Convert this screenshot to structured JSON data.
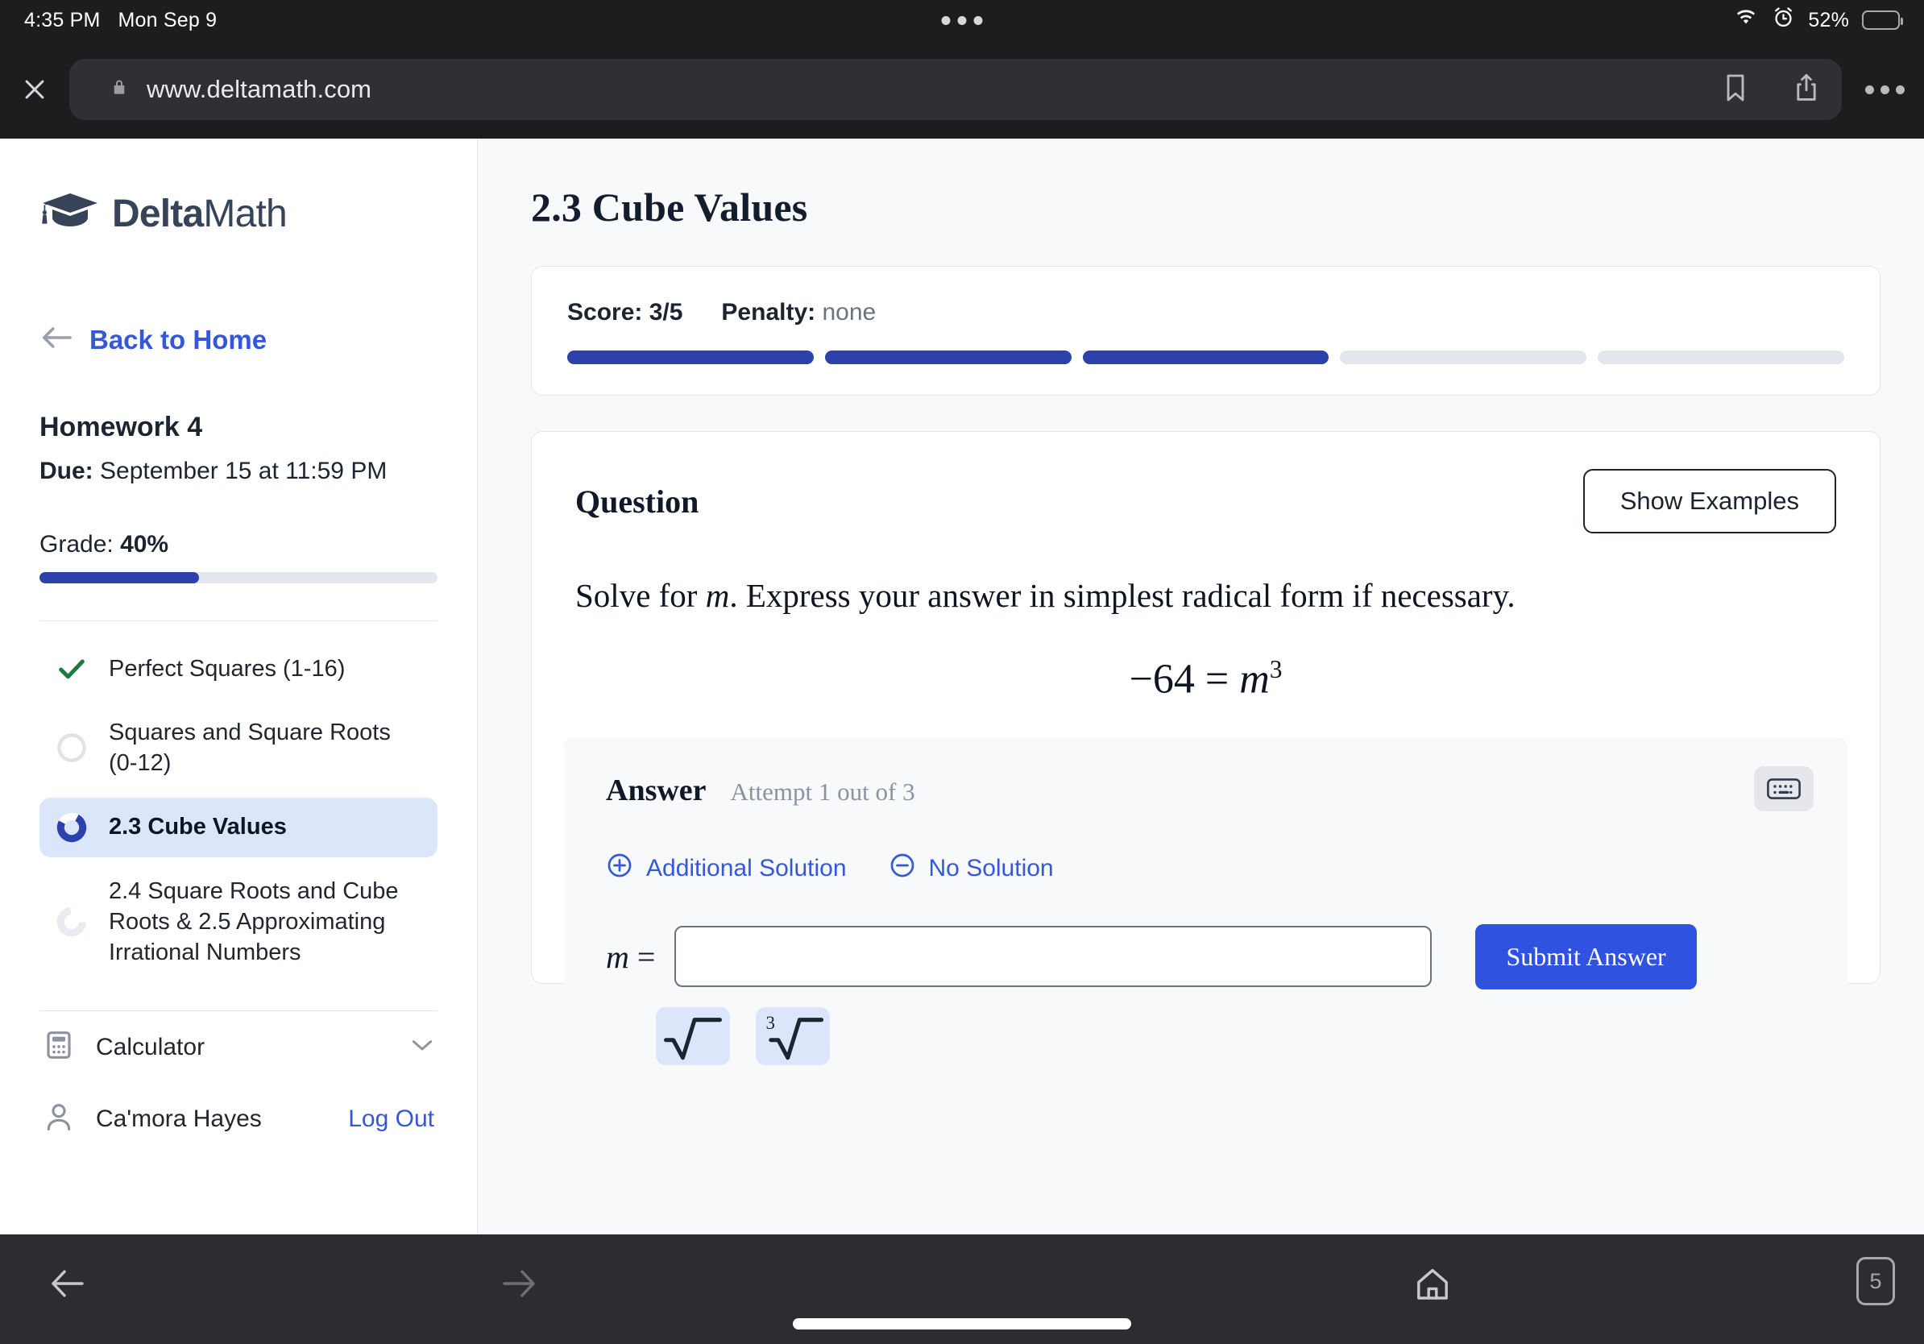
{
  "status_bar": {
    "time": "4:35 PM",
    "date": "Mon Sep 9",
    "battery_percent": "52%",
    "wifi_icon": "wifi-icon",
    "alarm_icon": "alarm-clock-icon",
    "battery_icon": "battery-icon",
    "battery_fill_color": "#f5cf1f"
  },
  "browser": {
    "close_icon": "close-icon",
    "lock_icon": "lock-icon",
    "url": "www.deltamath.com",
    "bookmark_icon": "bookmark-icon",
    "share_icon": "share-icon",
    "more_icon": "more-options-icon"
  },
  "sidebar": {
    "logo": {
      "bold": "Delta",
      "light": "Math",
      "icon": "graduation-cap-icon"
    },
    "back_label": "Back to Home",
    "back_icon": "arrow-left-icon",
    "homework_title": "Homework 4",
    "due_label": "Due:",
    "due_value": " September 15 at 11:59 PM",
    "grade_label": "Grade: ",
    "grade_value": "40%",
    "grade_percent": 40,
    "accent_color": "#2d41ab",
    "nav_items": [
      {
        "label": "Perfect Squares (1-16)",
        "status": "complete",
        "icon": "check-icon"
      },
      {
        "label": "Squares and Square Roots (0-12)",
        "status": "not-started",
        "icon": "empty-circle-icon"
      },
      {
        "label": "2.3 Cube Values",
        "status": "in-progress",
        "icon": "progress-ring-icon",
        "active": true
      },
      {
        "label": "2.4 Square Roots and Cube Roots & 2.5 Approximating Irrational Numbers",
        "status": "not-started",
        "icon": "progress-ring-icon"
      }
    ],
    "calculator_label": "Calculator",
    "calculator_icon": "calculator-icon",
    "chevron_icon": "chevron-down-icon",
    "user_name": "Ca'mora Hayes",
    "user_icon": "user-icon",
    "logout_label": "Log Out",
    "link_color": "#3558d9"
  },
  "main": {
    "page_title": "2.3 Cube Values",
    "score": {
      "score_label": "Score: 3/5",
      "penalty_label": "Penalty:",
      "penalty_value": " none",
      "segments_total": 5,
      "segments_filled": 3
    },
    "question": {
      "heading": "Question",
      "show_examples_label": "Show Examples",
      "prompt_before": "Solve for ",
      "prompt_var": "m",
      "prompt_after": ". Express your answer in simplest radical form if necessary.",
      "equation_lhs": "−64 = ",
      "equation_var": "m",
      "equation_exp": "3"
    },
    "answer": {
      "heading": "Answer",
      "attempt_text": "Attempt 1 out of 3",
      "keyboard_icon": "keyboard-icon",
      "additional_solution_label": "Additional Solution",
      "additional_solution_icon": "plus-circle-icon",
      "no_solution_label": "No Solution",
      "no_solution_icon": "minus-circle-icon",
      "variable_label": "m =",
      "input_value": "",
      "input_placeholder": "",
      "submit_label": "Submit Answer",
      "submit_color": "#2f53e0",
      "radical_buttons": [
        {
          "name": "square-root-button",
          "glyph": "√̅̅̅",
          "index": ""
        },
        {
          "name": "cube-root-button",
          "glyph": "√̅̅̅",
          "index": "3"
        }
      ]
    }
  },
  "bottom_bar": {
    "back_icon": "arrow-left-icon",
    "forward_icon": "arrow-right-icon",
    "home_icon": "home-icon",
    "tab_count": "5"
  }
}
